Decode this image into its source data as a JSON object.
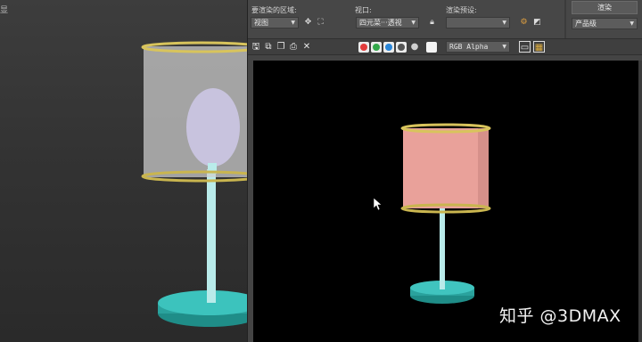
{
  "viewport": {
    "corner_label": "显"
  },
  "render_window": {
    "area_label": "要渲染的区域:",
    "area_value": "视图",
    "viewport_label": "视口:",
    "viewport_value": "四元菜···透视",
    "preset_label": "渲染预设:",
    "preset_value": "",
    "render_button": "渲染",
    "quality_value": "产品级",
    "channel_value": "RGB Alpha"
  },
  "icons": {
    "region_edit": "region-icon",
    "region_crop": "crop-icon",
    "lock": "lock-icon",
    "setup": "render-setup-icon",
    "env": "environment-icon",
    "save": "save-icon",
    "copy": "copy-icon",
    "clone": "clone-window-icon",
    "print": "print-icon",
    "clear": "clear-icon",
    "display_mono": "mono-icon",
    "color_swatch": "color-swatch-icon",
    "toggle_ui": "toggle-ui-icon",
    "frame_window": "frame-window-icon"
  },
  "colors": {
    "red_channel": "#e23b3b",
    "green_channel": "#33a84a",
    "blue_channel": "#2a86d8",
    "lamp_shade_render": "#e9a19a",
    "lamp_trim": "#d5c46a",
    "lamp_base": "#35b9b4"
  },
  "watermark": "知乎 @3DMAX"
}
